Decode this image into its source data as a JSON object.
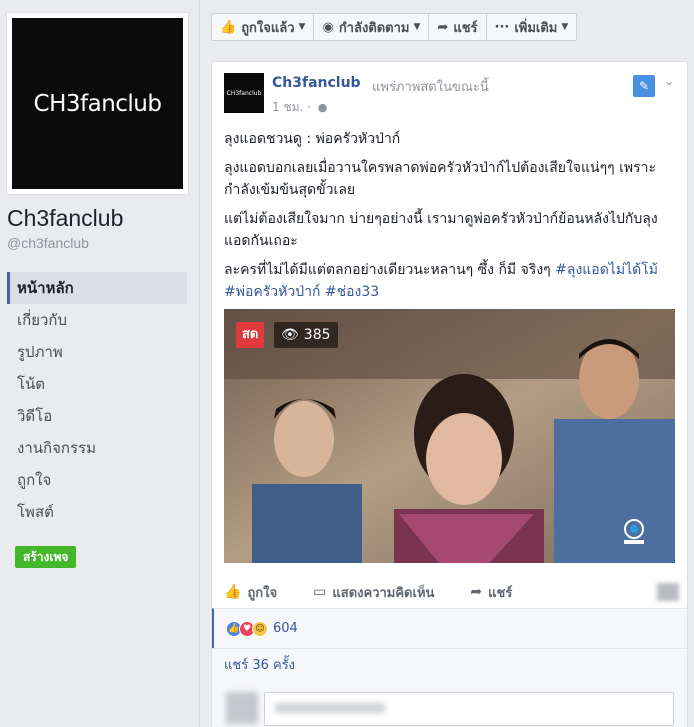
{
  "sidebar": {
    "logo_text": "CH3fanclub",
    "page_name": "Ch3fanclub",
    "page_handle": "@ch3fanclub",
    "nav": [
      {
        "label": "หน้าหลัก",
        "active": true
      },
      {
        "label": "เกี่ยวกับ"
      },
      {
        "label": "รูปภาพ"
      },
      {
        "label": "โน้ต"
      },
      {
        "label": "วิดีโอ"
      },
      {
        "label": "งานกิจกรรม"
      },
      {
        "label": "ถูกใจ"
      },
      {
        "label": "โพสต์"
      }
    ],
    "create_page": "สร้างเพจ"
  },
  "action_bar": {
    "liked": "ถูกใจแล้ว",
    "following": "กำลังติดตาม",
    "share": "แชร์",
    "more": "เพิ่มเติม"
  },
  "post": {
    "avatar_text": "CH3fanclub",
    "author": "Ch3fanclub",
    "action": "แพร่ภาพสดในขณะนี้",
    "time": "1 ชม. ·",
    "paragraphs": {
      "p1": "ลุงแอดชวนดู : พ่อครัวหัวป่าก์",
      "p2": "ลุงแอดบอกเลยเมื่อวานใครพลาดพ่อครัวหัวป่าก์ไปต้องเสียใจแน่ๆๆ เพราะ กำลังเข้มข้นสุดขั้วเลย",
      "p3": "แต่ไม่ต้องเสียใจมาก บ่ายๆอย่างนี้ เรามาดูพ่อครัวหัวป่าก์ย้อนหลังไปกับลุงแอดกันเถอะ",
      "p4_text": "ละครที่ไม่ได้มีแต่ตลกอย่างเดียวนะหลานๆ ซึ้ง ก็มี จริงๆ",
      "hashtags": "#ลุงแอดไม่ได้โม้ #พ่อครัวหัวป่าก์ #ช่อง33"
    },
    "video": {
      "live_label": "สด",
      "viewers": "385"
    },
    "actions": {
      "like": "ถูกใจ",
      "comment": "แสดงความคิดเห็น",
      "share": "แชร์"
    },
    "reaction_count": "604",
    "shares": "แชร์ 36 ครั้ง"
  },
  "colors": {
    "link": "#365899",
    "live": "#e0393e",
    "create_page": "#42b72a",
    "accent": "#4267b2"
  }
}
